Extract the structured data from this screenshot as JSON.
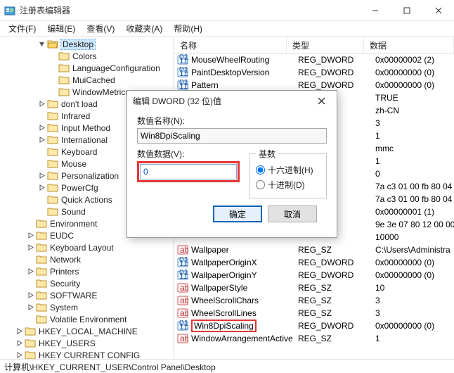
{
  "window": {
    "title": "注册表编辑器",
    "controls": {
      "min": "—",
      "max": "☐",
      "close": "✕"
    }
  },
  "menu": {
    "file": "文件(F)",
    "edit": "编辑(E)",
    "view": "查看(V)",
    "favorites": "收藏夹(A)",
    "help": "帮助(H)"
  },
  "tree": {
    "selected": "Desktop",
    "nodes": [
      {
        "indent": 3,
        "expand": "open",
        "label": "Desktop",
        "selected": true
      },
      {
        "indent": 4,
        "expand": "none",
        "label": "Colors"
      },
      {
        "indent": 4,
        "expand": "none",
        "label": "LanguageConfiguration"
      },
      {
        "indent": 4,
        "expand": "none",
        "label": "MuiCached"
      },
      {
        "indent": 4,
        "expand": "none",
        "label": "WindowMetrics"
      },
      {
        "indent": 3,
        "expand": "closed",
        "label": "don't load"
      },
      {
        "indent": 3,
        "expand": "none",
        "label": "Infrared"
      },
      {
        "indent": 3,
        "expand": "closed",
        "label": "Input Method"
      },
      {
        "indent": 3,
        "expand": "closed",
        "label": "International"
      },
      {
        "indent": 3,
        "expand": "none",
        "label": "Keyboard"
      },
      {
        "indent": 3,
        "expand": "none",
        "label": "Mouse"
      },
      {
        "indent": 3,
        "expand": "closed",
        "label": "Personalization"
      },
      {
        "indent": 3,
        "expand": "closed",
        "label": "PowerCfg"
      },
      {
        "indent": 3,
        "expand": "none",
        "label": "Quick Actions"
      },
      {
        "indent": 3,
        "expand": "none",
        "label": "Sound"
      },
      {
        "indent": 2,
        "expand": "none",
        "label": "Environment"
      },
      {
        "indent": 2,
        "expand": "closed",
        "label": "EUDC"
      },
      {
        "indent": 2,
        "expand": "closed",
        "label": "Keyboard Layout"
      },
      {
        "indent": 2,
        "expand": "none",
        "label": "Network"
      },
      {
        "indent": 2,
        "expand": "closed",
        "label": "Printers"
      },
      {
        "indent": 2,
        "expand": "none",
        "label": "Security"
      },
      {
        "indent": 2,
        "expand": "closed",
        "label": "SOFTWARE"
      },
      {
        "indent": 2,
        "expand": "closed",
        "label": "System"
      },
      {
        "indent": 2,
        "expand": "none",
        "label": "Volatile Environment"
      },
      {
        "indent": 1,
        "expand": "closed",
        "label": "HKEY_LOCAL_MACHINE"
      },
      {
        "indent": 1,
        "expand": "closed",
        "label": "HKEY_USERS"
      },
      {
        "indent": 1,
        "expand": "closed",
        "label": "HKEY CURRENT CONFIG"
      }
    ]
  },
  "list": {
    "cols": {
      "name": "名称",
      "type": "类型",
      "data": "数据"
    },
    "rows": [
      {
        "icon": "bin",
        "name": "MouseWheelRouting",
        "type": "REG_DWORD",
        "data": "0x00000002 (2)"
      },
      {
        "icon": "bin",
        "name": "PaintDesktopVersion",
        "type": "REG_DWORD",
        "data": "0x00000000 (0)"
      },
      {
        "icon": "bin",
        "name": "Pattern",
        "type": "REG_DWORD",
        "data": "0x00000000 (0)"
      },
      {
        "icon": "blank",
        "name": "",
        "type": "",
        "data": "TRUE"
      },
      {
        "icon": "blank",
        "name": "",
        "type": "",
        "data": "zh-CN"
      },
      {
        "icon": "blank",
        "name": "",
        "type": "",
        "data": "3"
      },
      {
        "icon": "blank",
        "name": "",
        "type": "",
        "data": "1"
      },
      {
        "icon": "blank",
        "name": "",
        "type": "",
        "data": "mmc"
      },
      {
        "icon": "blank",
        "name": "",
        "type": "",
        "data": "1"
      },
      {
        "icon": "blank",
        "name": "",
        "type": "",
        "data": "0"
      },
      {
        "icon": "blank",
        "name": "",
        "type": "",
        "data": "7a c3 01 00 fb 80 04"
      },
      {
        "icon": "blank",
        "name": "",
        "type": "",
        "data": "7a c3 01 00 fb 80 04"
      },
      {
        "icon": "blank",
        "name": "",
        "type": "",
        "data": "0x00000001 (1)"
      },
      {
        "icon": "blank",
        "name": "",
        "type": "",
        "data": "9e 3e 07 80 12 00 00"
      },
      {
        "icon": "blank",
        "name": "",
        "type": "",
        "data": "10000"
      },
      {
        "icon": "str",
        "name": "Wallpaper",
        "type": "REG_SZ",
        "data": "C:\\Users\\Administra"
      },
      {
        "icon": "bin",
        "name": "WallpaperOriginX",
        "type": "REG_DWORD",
        "data": "0x00000000 (0)"
      },
      {
        "icon": "bin",
        "name": "WallpaperOriginY",
        "type": "REG_DWORD",
        "data": "0x00000000 (0)"
      },
      {
        "icon": "str",
        "name": "WallpaperStyle",
        "type": "REG_SZ",
        "data": "10"
      },
      {
        "icon": "str",
        "name": "WheelScrollChars",
        "type": "REG_SZ",
        "data": "3"
      },
      {
        "icon": "str",
        "name": "WheelScrollLines",
        "type": "REG_SZ",
        "data": "3"
      },
      {
        "icon": "bin",
        "name": "Win8DpiScaling",
        "type": "REG_DWORD",
        "data": "0x00000000 (0)",
        "hilite": true
      },
      {
        "icon": "str",
        "name": "WindowArrangementActive",
        "type": "REG_SZ",
        "data": "1"
      }
    ]
  },
  "dialog": {
    "title": "编辑 DWORD (32 位)值",
    "name_label": "数值名称(N):",
    "name_value": "Win8DpiScaling",
    "value_label": "数值数据(V):",
    "value_data": "0",
    "base_legend": "基数",
    "radix_hex": "十六进制(H)",
    "radix_dec": "十进制(D)",
    "ok": "确定",
    "cancel": "取消"
  },
  "statusbar": "计算机\\HKEY_CURRENT_USER\\Control Panel\\Desktop"
}
